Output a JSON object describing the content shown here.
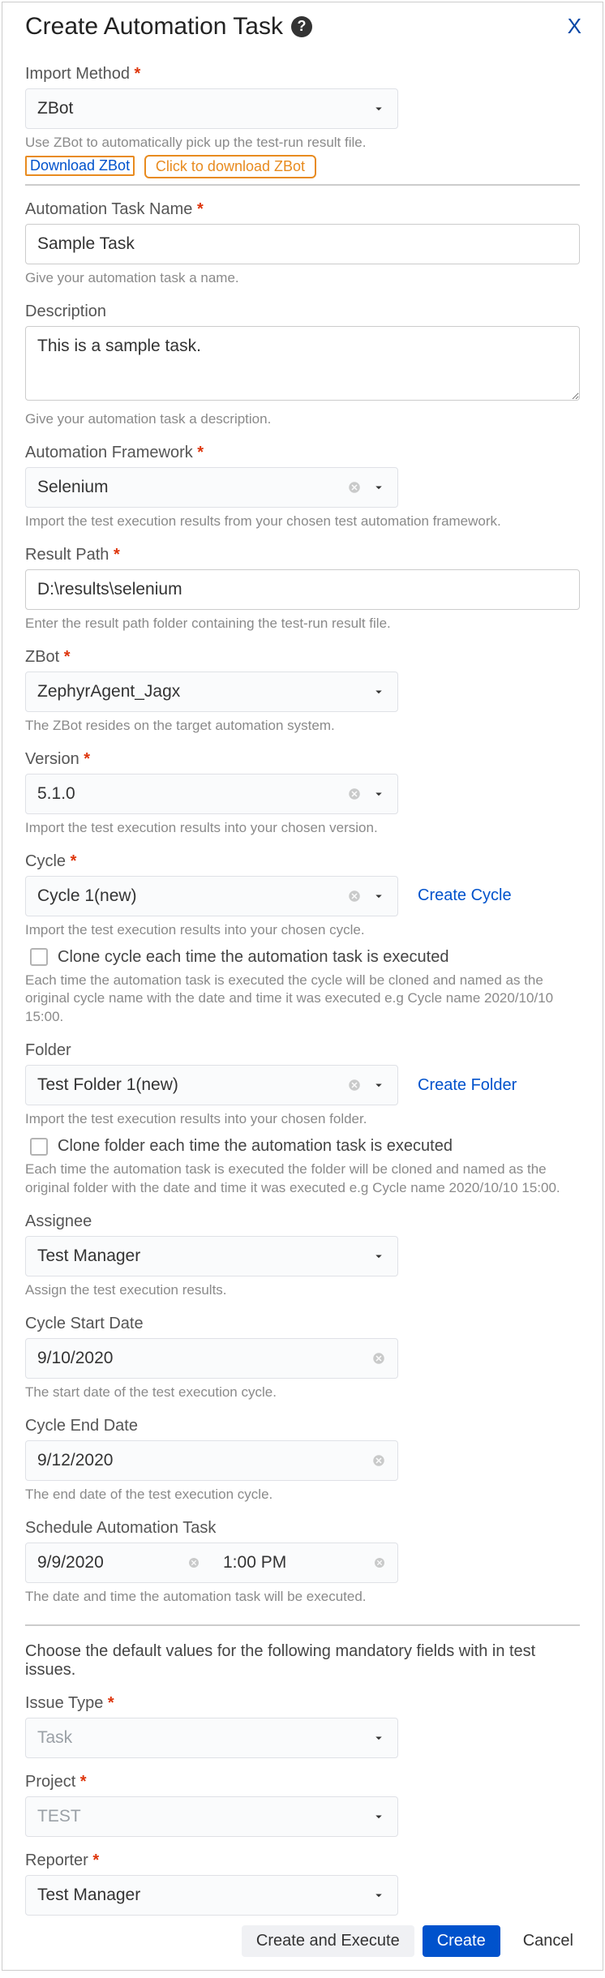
{
  "dialog": {
    "title": "Create Automation Task",
    "close": "X"
  },
  "importMethod": {
    "label": "Import Method",
    "value": "ZBot",
    "hint": "Use ZBot to automatically pick up the test-run result file.",
    "downloadLink": "Download ZBot",
    "callout": "Click to download ZBot"
  },
  "taskName": {
    "label": "Automation Task Name",
    "value": "Sample Task",
    "hint": "Give your automation task a name."
  },
  "description": {
    "label": "Description",
    "value": "This is a sample task.",
    "hint": "Give your automation task a description."
  },
  "framework": {
    "label": "Automation Framework",
    "value": "Selenium",
    "hint": "Import the test execution results from your chosen test automation framework."
  },
  "resultPath": {
    "label": "Result Path",
    "value": "D:\\results\\selenium",
    "hint": "Enter the result path folder containing the test-run result file."
  },
  "zbot": {
    "label": "ZBot",
    "value": "ZephyrAgent_Jagx",
    "hint": "The ZBot resides on the target automation system."
  },
  "version": {
    "label": "Version",
    "value": "5.1.0",
    "hint": "Import the test execution results into your chosen version."
  },
  "cycle": {
    "label": "Cycle",
    "value": "Cycle 1(new)",
    "sideLink": "Create Cycle",
    "hint": "Import the test execution results into your chosen cycle.",
    "cloneLabel": "Clone cycle each time the automation task is executed",
    "cloneHint": "Each time the automation task is executed the cycle will be cloned and named as the original cycle name with the date and time it was executed e.g Cycle name 2020/10/10 15:00."
  },
  "folder": {
    "label": "Folder",
    "value": "Test Folder 1(new)",
    "sideLink": "Create Folder",
    "hint": "Import the test execution results into your chosen folder.",
    "cloneLabel": "Clone folder each time the automation task is executed",
    "cloneHint": "Each time the automation task is executed the folder will be cloned and named as the original folder with the date and time it was executed e.g Cycle name 2020/10/10 15:00."
  },
  "assignee": {
    "label": "Assignee",
    "value": "Test Manager",
    "hint": "Assign the test execution results."
  },
  "cycleStart": {
    "label": "Cycle Start Date",
    "value": "9/10/2020",
    "hint": "The start date of the test execution cycle."
  },
  "cycleEnd": {
    "label": "Cycle End Date",
    "value": "9/12/2020",
    "hint": "The end date of the test execution cycle."
  },
  "schedule": {
    "label": "Schedule Automation Task",
    "date": "9/9/2020",
    "time": "1:00 PM",
    "hint": "The date and time the automation task will be executed."
  },
  "defaultsNote": "Choose the default values for the following mandatory fields with in test issues.",
  "issueType": {
    "label": "Issue Type",
    "value": "Task"
  },
  "project": {
    "label": "Project",
    "value": "TEST"
  },
  "reporter": {
    "label": "Reporter",
    "value": "Test Manager"
  },
  "footer": {
    "createExecute": "Create and Execute",
    "create": "Create",
    "cancel": "Cancel"
  }
}
